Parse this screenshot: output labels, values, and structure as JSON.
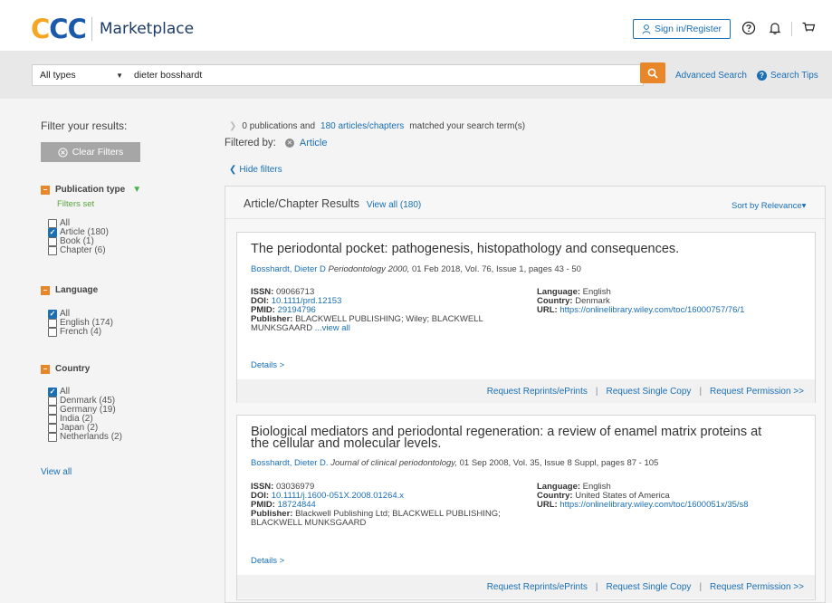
{
  "header": {
    "logo_text": "CCC",
    "product": "Marketplace",
    "signin_label": "Sign in/Register",
    "icons": [
      "user-icon",
      "help-icon",
      "bell-icon",
      "cart-icon"
    ]
  },
  "search": {
    "type_selected": "All types",
    "query": "dieter bosshardt",
    "advanced_label": "Advanced Search",
    "tips_label": "Search Tips"
  },
  "sidebar": {
    "title": "Filter your results:",
    "clear_label": "Clear Filters",
    "facets": [
      {
        "title": "Publication type",
        "status": "Filters set",
        "options": [
          {
            "label": "All",
            "checked": false
          },
          {
            "label": "Article (180)",
            "checked": true
          },
          {
            "label": "Book (1)",
            "checked": false
          },
          {
            "label": "Chapter (6)",
            "checked": false
          }
        ]
      },
      {
        "title": "Language",
        "options": [
          {
            "label": "All",
            "checked": true
          },
          {
            "label": "English (174)",
            "checked": false
          },
          {
            "label": "French (4)",
            "checked": false
          }
        ]
      },
      {
        "title": "Country",
        "options": [
          {
            "label": "All",
            "checked": true
          },
          {
            "label": "Denmark (45)",
            "checked": false
          },
          {
            "label": "Germany (19)",
            "checked": false
          },
          {
            "label": "India (2)",
            "checked": false
          },
          {
            "label": "Japan (2)",
            "checked": false
          },
          {
            "label": "Netherlands (2)",
            "checked": false
          }
        ]
      }
    ],
    "view_all": "View all"
  },
  "summary": {
    "pubs_text": "0 publications and",
    "articles_link": "180 articles/chapters",
    "tail": "matched your search term(s)",
    "filtered_label": "Filtered by:",
    "filter_value": "Article",
    "hide_filters": "Hide filters"
  },
  "results": {
    "heading": "Article/Chapter Results",
    "view_all": "View all (180)",
    "sort_label": "Sort by Relevance",
    "labels": {
      "issn": "ISSN:",
      "doi": "DOI:",
      "pmid": "PMID:",
      "publisher": "Publisher:",
      "language": "Language:",
      "country": "Country:",
      "url": "URL:",
      "details": "Details >",
      "reprints": "Request Reprints/ePrints",
      "single": "Request Single Copy",
      "permission": "Request Permission >>",
      "pipe": "|"
    },
    "items": [
      {
        "title_line1": "The periodontal pocket: pathogenesis, histopathology and consequences.",
        "title_line2": "",
        "author": "Bosshardt, Dieter D",
        "journal": "Periodontology 2000,",
        "pub_info": "01 Feb 2018, Vol. 76, Issue 1, pages 43 - 50",
        "issn": "09066713",
        "doi": "10.1111/prd.12153",
        "pmid": "29194796",
        "publisher_line1": "BLACKWELL PUBLISHING; Wiley; BLACKWELL",
        "publisher_line2": "MUNKSGAARD",
        "publisher_more": "...view all",
        "language": "English",
        "country": "Denmark",
        "url": "https://onlinelibrary.wiley.com/toc/16000757/76/1"
      },
      {
        "title_line1": "Biological mediators and periodontal regeneration: a review of enamel matrix proteins at",
        "title_line2": "the cellular and molecular levels.",
        "author": "Bosshardt, Dieter D.",
        "journal": "Journal of clinical periodontology,",
        "pub_info": "01 Sep 2008, Vol. 35, Issue 8 Suppl, pages 87 - 105",
        "issn": "03036979",
        "doi": "10.1111/j.1600-051X.2008.01264.x",
        "pmid": "18724844",
        "publisher_line1": "Blackwell Publishing Ltd; BLACKWELL PUBLISHING;",
        "publisher_line2": "BLACKWELL MUNKSGAARD",
        "publisher_more": "",
        "language": "English",
        "country": "United States of America",
        "url": "https://onlinelibrary.wiley.com/toc/1600051x/35/s8"
      }
    ]
  }
}
